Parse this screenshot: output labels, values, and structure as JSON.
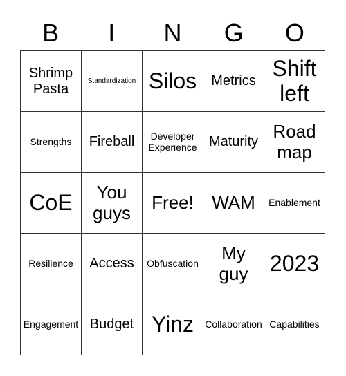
{
  "header": [
    "B",
    "I",
    "N",
    "G",
    "O"
  ],
  "cells": [
    {
      "text": "Shrimp Pasta",
      "size": "m"
    },
    {
      "text": "Standardization",
      "size": "xs"
    },
    {
      "text": "Silos",
      "size": "xl"
    },
    {
      "text": "Metrics",
      "size": "m"
    },
    {
      "text": "Shift left",
      "size": "xl"
    },
    {
      "text": "Strengths",
      "size": "s"
    },
    {
      "text": "Fireball",
      "size": "m"
    },
    {
      "text": "Developer Experience",
      "size": "s"
    },
    {
      "text": "Maturity",
      "size": "m"
    },
    {
      "text": "Road map",
      "size": "l"
    },
    {
      "text": "CoE",
      "size": "xl"
    },
    {
      "text": "You guys",
      "size": "l"
    },
    {
      "text": "Free!",
      "size": "l"
    },
    {
      "text": "WAM",
      "size": "l"
    },
    {
      "text": "Enablement",
      "size": "s"
    },
    {
      "text": "Resilience",
      "size": "s"
    },
    {
      "text": "Access",
      "size": "m"
    },
    {
      "text": "Obfuscation",
      "size": "s"
    },
    {
      "text": "My guy",
      "size": "l"
    },
    {
      "text": "2023",
      "size": "xl"
    },
    {
      "text": "Engagement",
      "size": "s"
    },
    {
      "text": "Budget",
      "size": "m"
    },
    {
      "text": "Yinz",
      "size": "xl"
    },
    {
      "text": "Collaboration",
      "size": "s"
    },
    {
      "text": "Capabilities",
      "size": "s"
    }
  ]
}
